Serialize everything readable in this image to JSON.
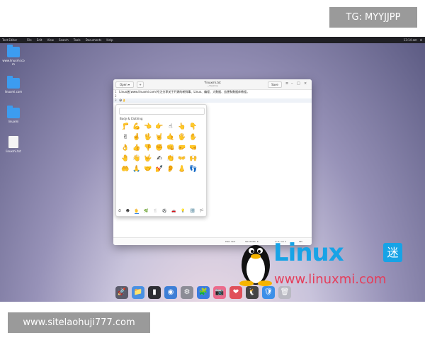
{
  "overlay": {
    "top_tag": "TG: MYYJJPP",
    "bottom_tag": "www.sitelaohuji777.com"
  },
  "topbar": {
    "app_name": "Text Editor",
    "menu": [
      "File",
      "Edit",
      "View",
      "Search",
      "Tools",
      "Documents",
      "Help"
    ],
    "clock": "13:14 am"
  },
  "desktop": {
    "icons": [
      {
        "label": "www.linuxmi.co m",
        "type": "folder"
      },
      {
        "label": "linuxmi.com",
        "type": "folder"
      },
      {
        "label": "linuxmi",
        "type": "folder"
      },
      {
        "label": "linuxmi.txt",
        "type": "file"
      }
    ]
  },
  "editor_window": {
    "title": "*linuxmi.txt",
    "subtitle": "~/Desktop",
    "open_label": "Open",
    "save_label": "Save",
    "lines": [
      {
        "num": "1",
        "text": "Linux迷(www.linuxmi.com)专注分享关于开源的新鲜事、Linux、编程、大数据、云便和数据库教程。"
      },
      {
        "num": "2",
        "text": ""
      },
      {
        "num": "3",
        "text": "😀👌"
      }
    ],
    "status": {
      "format": "Plain Text",
      "tab_width": "Tab Width: 8",
      "position": "Ln 3, Col 3",
      "mode": "INS"
    }
  },
  "emoji_picker": {
    "category": "Body & Clothing",
    "emojis": [
      "🦵",
      "💪",
      "👈",
      "👉",
      "☝",
      "👆",
      "👇",
      "✌",
      "🤞",
      "🖖",
      "🤘",
      "🤙",
      "🖐",
      "✋",
      "👌",
      "👍",
      "👎",
      "✊",
      "👊",
      "🤛",
      "🤜",
      "🤚",
      "👋",
      "🤟",
      "✍",
      "👏",
      "👐",
      "🙌",
      "🤲",
      "🙏",
      "🤝",
      "💅",
      "👂",
      "👃",
      "👣"
    ],
    "tabs": [
      "⏱",
      "☻",
      "🖐",
      "🌿",
      "🍴",
      "⚽",
      "🚗",
      "💡",
      "🔣",
      "🏳"
    ]
  },
  "dock": {
    "apps": [
      {
        "icon": "🚀",
        "color": "#5b5b6b"
      },
      {
        "icon": "📁",
        "color": "#4a90e2"
      },
      {
        "icon": "▮",
        "color": "#2e2e34"
      },
      {
        "icon": "◉",
        "color": "#3e7fd6"
      },
      {
        "icon": "⚙",
        "color": "#8c8c96"
      },
      {
        "icon": "🧩",
        "color": "#3a7be0"
      },
      {
        "icon": "📷",
        "color": "#ec6b8c"
      },
      {
        "icon": "❤",
        "color": "#e0505a"
      },
      {
        "icon": "🐧",
        "color": "#444444"
      },
      {
        "icon": "🛡",
        "color": "#3b8fe8"
      },
      {
        "icon": "🗑",
        "color": "#b9b9c2"
      }
    ]
  },
  "watermark": {
    "brand": "Linux",
    "badge": "迷",
    "url": "www.linuxmi.com"
  }
}
